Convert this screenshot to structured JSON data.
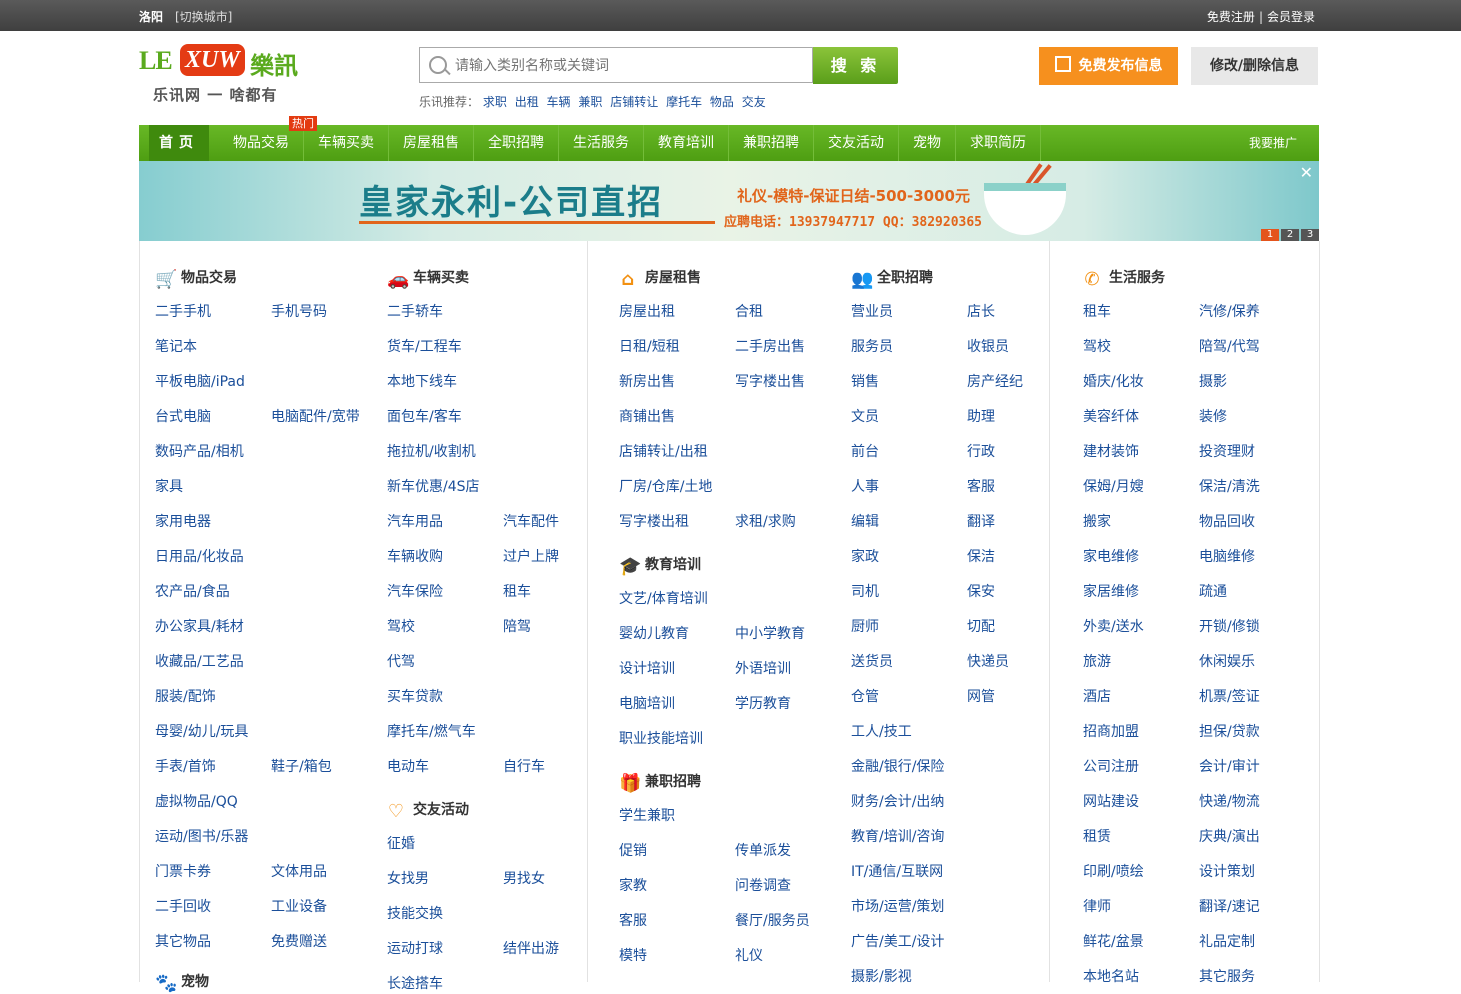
{
  "topbar": {
    "city": "洛阳",
    "switch": "[切换城市]",
    "register": "免费注册",
    "sep": "|",
    "login": "会员登录"
  },
  "logo": {
    "le": "LE",
    "xuw": "XUW",
    "cn": "樂訊",
    "slogan": "乐讯网 一 啥都有"
  },
  "search": {
    "placeholder": "请输入类别名称或关键词",
    "button": "搜 索",
    "hot_label": "乐讯推荐：",
    "hot": [
      "求职",
      "出租",
      "车辆",
      "兼职",
      "店铺转让",
      "摩托车",
      "物品",
      "交友"
    ]
  },
  "buttons": {
    "publish": "免费发布信息",
    "edit": "修改/删除信息"
  },
  "nav": {
    "home": "首页",
    "badge": "热门",
    "items": [
      "物品交易",
      "车辆买卖",
      "房屋租售",
      "全职招聘",
      "生活服务",
      "教育培训",
      "兼职招聘",
      "交友活动",
      "宠物",
      "求职简历"
    ],
    "promo": "我要推广"
  },
  "banner": {
    "title": "皇家永利-公司直招",
    "subtitle": "礼仪-模特-保证日结-500-3000元",
    "phone": "应聘电话：13937947717 QQ：382920365",
    "close": "✕",
    "pages": [
      "1",
      "2",
      "3"
    ]
  },
  "sections": {
    "goods": {
      "title": "物品交易",
      "icon": "cart-icon",
      "links": [
        "二手手机",
        "手机号码",
        "笔记本",
        "平板电脑/iPad",
        "台式电脑",
        "电脑配件/宽带",
        "数码产品/相机",
        "家具",
        "家用电器",
        "日用品/化妆品",
        "农产品/食品",
        "办公家具/耗材",
        "收藏品/工艺品",
        "服装/配饰",
        "母婴/幼儿/玩具",
        "手表/首饰",
        "鞋子/箱包",
        "虚拟物品/QQ",
        "运动/图书/乐器",
        "门票卡券",
        "文体用品",
        "二手回收",
        "工业设备",
        "其它物品",
        "免费赠送"
      ]
    },
    "pets": {
      "title": "宠物"
    },
    "cars": {
      "title": "车辆买卖",
      "icon": "car-icon",
      "links": [
        "二手轿车",
        "货车/工程车",
        "本地下线车",
        "面包车/客车",
        "拖拉机/收割机",
        "新车优惠/4S店",
        "汽车用品",
        "汽车配件",
        "车辆收购",
        "过户上牌",
        "汽车保险",
        "租车",
        "驾校",
        "陪驾",
        "代驾",
        "买车贷款",
        "摩托车/燃气车",
        "电动车",
        "自行车"
      ]
    },
    "dating": {
      "title": "交友活动",
      "icon": "heart-icon",
      "links": [
        "征婚",
        "女找男",
        "男找女",
        "技能交换",
        "运动打球",
        "结伴出游",
        "长途搭车"
      ]
    },
    "house": {
      "title": "房屋租售",
      "icon": "house-icon",
      "links": [
        "房屋出租",
        "合租",
        "日租/短租",
        "二手房出售",
        "新房出售",
        "写字楼出售",
        "商铺出售",
        "店铺转让/出租",
        "厂房/仓库/土地",
        "写字楼出租",
        "求租/求购"
      ]
    },
    "edu": {
      "title": "教育培训",
      "icon": "graduation-cap-icon",
      "links": [
        "文艺/体育培训",
        "婴幼儿教育",
        "中小学教育",
        "设计培训",
        "外语培训",
        "电脑培训",
        "学历教育",
        "职业技能培训"
      ]
    },
    "parttime": {
      "title": "兼职招聘",
      "icon": "gift-icon",
      "links": [
        "学生兼职",
        "促销",
        "传单派发",
        "家教",
        "问卷调查",
        "客服",
        "餐厅/服务员",
        "模特",
        "礼仪"
      ]
    },
    "fulltime": {
      "title": "全职招聘",
      "icon": "people-icon",
      "links": [
        "营业员",
        "店长",
        "服务员",
        "收银员",
        "销售",
        "房产经纪",
        "文员",
        "助理",
        "前台",
        "行政",
        "人事",
        "客服",
        "编辑",
        "翻译",
        "家政",
        "保洁",
        "司机",
        "保安",
        "厨师",
        "切配",
        "送货员",
        "快递员",
        "仓管",
        "网管",
        "工人/技工",
        "金融/银行/保险",
        "财务/会计/出纳",
        "教育/培训/咨询",
        "IT/通信/互联网",
        "市场/运营/策划",
        "广告/美工/设计",
        "摄影/影视"
      ]
    },
    "life": {
      "title": "生活服务",
      "icon": "phone-icon",
      "links": [
        "租车",
        "汽修/保养",
        "驾校",
        "陪驾/代驾",
        "婚庆/化妆",
        "摄影",
        "美容纤体",
        "装修",
        "建材装饰",
        "投资理财",
        "保姆/月嫂",
        "保洁/清洗",
        "搬家",
        "物品回收",
        "家电维修",
        "电脑维修",
        "家居维修",
        "疏通",
        "外卖/送水",
        "开锁/修锁",
        "旅游",
        "休闲娱乐",
        "酒店",
        "机票/签证",
        "招商加盟",
        "担保/贷款",
        "公司注册",
        "会计/审计",
        "网站建设",
        "快递/物流",
        "租赁",
        "庆典/演出",
        "印刷/喷绘",
        "设计策划",
        "律师",
        "翻译/速记",
        "鲜花/盆景",
        "礼品定制",
        "本地名站",
        "其它服务"
      ]
    }
  }
}
